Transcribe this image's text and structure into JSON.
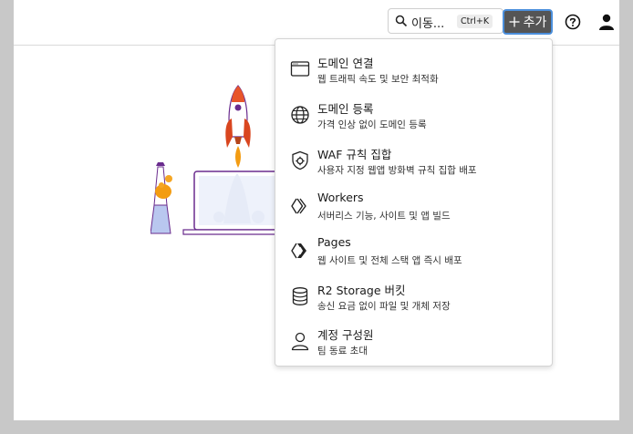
{
  "header": {
    "search": {
      "text": "이동...",
      "shortcut": "Ctrl+K"
    },
    "add_button": {
      "label": "추가"
    }
  },
  "menu": {
    "items": [
      {
        "title": "도메인 연결",
        "desc": "웹 트래픽 속도 및 보안 최적화",
        "icon": "browser-window-icon"
      },
      {
        "title": "도메인 등록",
        "desc": "가격 인상 없이 도메인 등록",
        "icon": "globe-icon"
      },
      {
        "title": "WAF 규칙 집합",
        "desc": "사용자 지정 웹앱 방화벽 규칙 집합 배포",
        "icon": "shield-gear-icon"
      },
      {
        "title": "Workers",
        "desc": "서버리스 기능, 사이트 및 앱 빌드",
        "icon": "workers-icon"
      },
      {
        "title": "Pages",
        "desc": "웹 사이트 및 전체 스택 앱 즉시 배포",
        "icon": "pages-icon"
      },
      {
        "title": "R2 Storage 버킷",
        "desc": "송신 요금 없이 파일 및 개체 저장",
        "icon": "database-icon"
      },
      {
        "title": "계정 구성원",
        "desc": "팀 동료 초대",
        "icon": "person-icon"
      }
    ]
  },
  "colors": {
    "accent_border": "#4b8fdc",
    "button_bg": "#555555",
    "rocket": "#d9461f",
    "lava": "#f39c12"
  }
}
